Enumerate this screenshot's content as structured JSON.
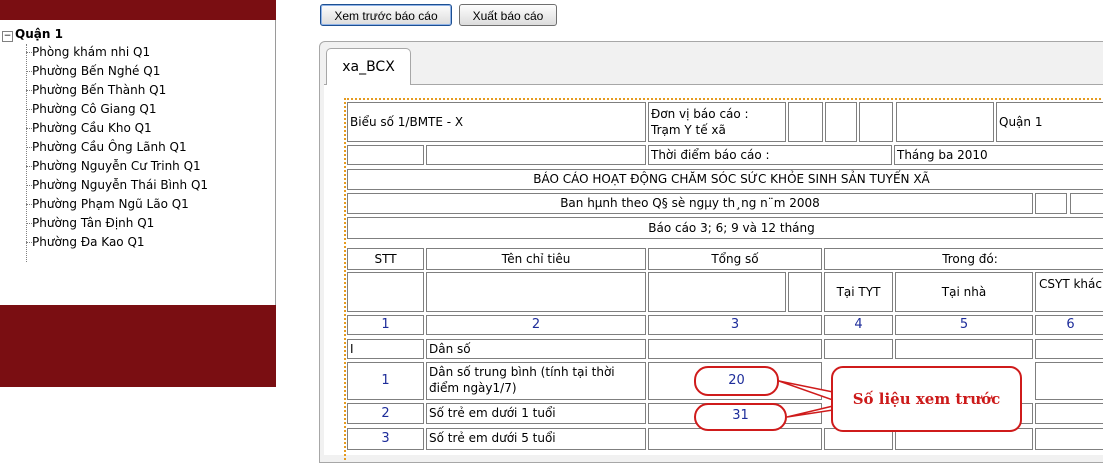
{
  "toolbar": {
    "preview_label": "Xem trước báo cáo",
    "export_label": "Xuất báo cáo"
  },
  "tree": {
    "toggle": "−",
    "root": "Quận 1",
    "items": [
      "Phòng khám nhi Q1",
      "Phường Bến Nghé Q1",
      "Phường Bến Thành Q1",
      "Phường Cô Giang Q1",
      "Phường Cầu Kho Q1",
      "Phường Cầu Ông Lãnh Q1",
      "Phường Nguyễn Cư Trinh Q1",
      "Phường Nguyễn Thái Bình Q1",
      "Phường Phạm Ngũ Lão Q1",
      "Phường Tân Định Q1",
      "Phường Đa Kao Q1"
    ]
  },
  "tab": {
    "label": "xa_BCX"
  },
  "report": {
    "form_code": "Biểu số 1/BMTE - X",
    "unit_label": "Đơn vị báo cáo :",
    "unit_value": "Trạm Y tế xã",
    "district": "Quận 1",
    "time_label": "Thời điểm báo cáo :",
    "time_value": "Tháng ba 2010",
    "title": "BÁO CÁO HOẠT ĐỘNG CHĂM SÓC SỨC KHỎE SINH SẢN TUYẾN XÃ",
    "decree": "Ban hµnh theo Q§ sè ngµy th¸ng n¨m 2008",
    "period": "Báo cáo 3; 6; 9 và 12 tháng",
    "headers": {
      "stt": "STT",
      "indicator": "Tên chỉ tiêu",
      "total": "Tổng số",
      "of_which": "Trong đó:",
      "at_station": "Tại TYT",
      "at_home": "Tại nhà",
      "other": "CSYT khác"
    },
    "column_numbers": [
      "1",
      "2",
      "3",
      "4",
      "5",
      "6"
    ],
    "rows": [
      {
        "stt": "I",
        "name": "Dân số",
        "total": ""
      },
      {
        "stt": "1",
        "name": "Dân số trung bình (tính tại thời điểm ngày1/7)",
        "total": "20"
      },
      {
        "stt": "2",
        "name": "Số trẻ em dưới 1 tuổi",
        "total": "31"
      },
      {
        "stt": "3",
        "name": "Số trẻ em dưới 5 tuổi",
        "total": ""
      }
    ]
  },
  "callout": {
    "text": "Số liệu xem trước"
  },
  "colors": {
    "brand": "#7a0e12",
    "callout": "#cf1b1b",
    "value_text": "#1e2d9a",
    "border_dotted": "#e59b20"
  }
}
